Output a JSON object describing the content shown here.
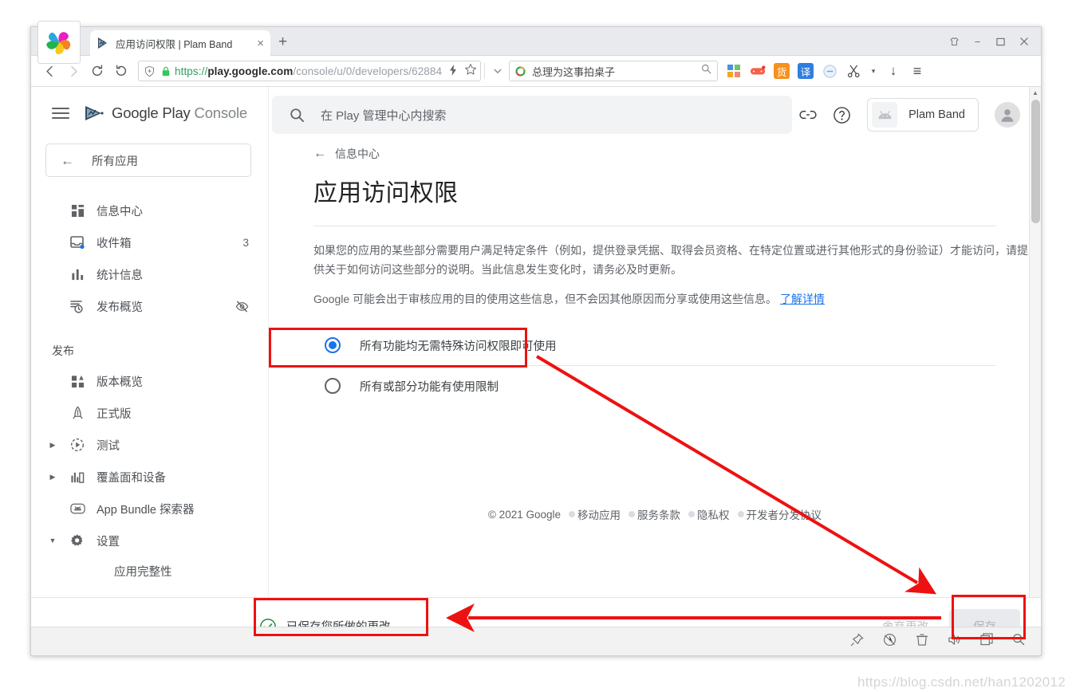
{
  "browser": {
    "tab": {
      "title": "应用访问权限 | Plam Band",
      "favicon": "play-console-favicon",
      "close_label": "×"
    },
    "new_tab_label": "+",
    "window_controls": {
      "shirt": "shirt-icon",
      "minimize": "−",
      "maximize": "□",
      "close": "×"
    },
    "nav": {
      "back": "‹",
      "forward": "›",
      "reload": "⟳",
      "stop_back": "↺"
    },
    "omnibox": {
      "shield_icon": "shield-plus-icon",
      "lock_icon": "lock-icon",
      "url_scheme": "https://",
      "url_host": "play.google.com",
      "url_path": "/console/u/0/developers/62884",
      "bolt_icon": "lightning-icon",
      "star_icon": "star-icon",
      "chevron_icon": "chevron-down-icon"
    },
    "search": {
      "engine_icon": "360-search-icon",
      "value": "总理为这事拍桌子",
      "submit_icon": "search-icon"
    },
    "extensions": [
      {
        "name": "apps-grid-icon",
        "glyph": ""
      },
      {
        "name": "game-controller-icon",
        "glyph": ""
      },
      {
        "name": "coupon-icon",
        "glyph": "货"
      },
      {
        "name": "translate-icon",
        "glyph": "译"
      },
      {
        "name": "adblock-icon",
        "glyph": ""
      },
      {
        "name": "scissors-icon",
        "glyph": "✂"
      },
      {
        "name": "scissors-dropdown-icon",
        "glyph": "▾"
      },
      {
        "name": "download-icon",
        "glyph": "↓"
      },
      {
        "name": "menu-icon",
        "glyph": "≡"
      }
    ],
    "status_icons": [
      "pin-icon",
      "shield-speed-icon",
      "trash-icon",
      "volume-icon",
      "window-icon",
      "search-icon"
    ]
  },
  "console": {
    "brand": {
      "google_play": "Google Play",
      "console": "Console",
      "logo": "play-console-logo"
    },
    "menu_icon": "hamburger-icon",
    "all_apps": {
      "label": "所有应用",
      "back_icon": "arrow-left-icon"
    },
    "search": {
      "placeholder": "在 Play 管理中心内搜索",
      "icon": "search-icon"
    },
    "header_actions": {
      "link_icon": "link-icon",
      "help_icon": "help-circle-icon",
      "app_name": "Plam Band",
      "app_icon": "android-head-icon",
      "account_icon": "account-avatar-icon"
    },
    "sidebar": {
      "items": [
        {
          "label": "信息中心",
          "icon": "dashboard-icon",
          "badge": "",
          "caret": ""
        },
        {
          "label": "收件箱",
          "icon": "inbox-icon",
          "badge": "3",
          "caret": ""
        },
        {
          "label": "统计信息",
          "icon": "statistics-icon",
          "badge": "",
          "caret": ""
        },
        {
          "label": "发布概览",
          "icon": "publishing-overview-icon",
          "badge": "eye-off-icon",
          "caret": ""
        }
      ],
      "section_label": "发布",
      "publish_items": [
        {
          "label": "版本概览",
          "icon": "release-overview-icon",
          "caret": ""
        },
        {
          "label": "正式版",
          "icon": "production-icon",
          "caret": ""
        },
        {
          "label": "测试",
          "icon": "testing-icon",
          "caret": "▶"
        },
        {
          "label": "覆盖面和设备",
          "icon": "reach-devices-icon",
          "caret": "▶"
        },
        {
          "label": "App Bundle 探索器",
          "icon": "app-bundle-icon",
          "caret": ""
        },
        {
          "label": "设置",
          "icon": "gear-icon",
          "caret": "▼"
        }
      ],
      "sub_item": "应用完整性"
    },
    "main": {
      "breadcrumb": {
        "arrow": "←",
        "label": "信息中心"
      },
      "title": "应用访问权限",
      "paragraph1": "如果您的应用的某些部分需要用户满足特定条件（例如，提供登录凭据、取得会员资格、在特定位置或进行其他形式的身份验证）才能访问，请提供关于如何访问这些部分的说明。当此信息发生变化时，请务必及时更新。",
      "paragraph2": "Google 可能会出于审核应用的目的使用这些信息，但不会因其他原因而分享或使用这些信息。",
      "paragraph2_link": "了解详情",
      "options": [
        {
          "label": "所有功能均无需特殊访问权限即可使用",
          "selected": true
        },
        {
          "label": "所有或部分功能有使用限制",
          "selected": false
        }
      ]
    },
    "footer": {
      "copyright": "© 2021 Google",
      "links": [
        "移动应用",
        "服务条款",
        "隐私权",
        "开发者分发协议"
      ]
    },
    "action_bar": {
      "saved_message": "已保存您所做的更改",
      "saved_icon": "check-circle-icon",
      "discard_label": "舍弃更改",
      "save_label": "保存"
    }
  },
  "annotations": {
    "color": "#ee1111",
    "boxes": [
      "selected-radio-option",
      "saved-message",
      "save-button"
    ],
    "arrows": [
      "diagonal-arrow-to-save",
      "horizontal-arrow-to-saved-message"
    ]
  },
  "watermark": "https://blog.csdn.net/han1202012",
  "colors": {
    "accent_blue": "#1a73e8",
    "annotation_red": "#ee1111",
    "success_green": "#1e8e3e",
    "text_primary": "#202124",
    "text_secondary": "#5f6368"
  }
}
